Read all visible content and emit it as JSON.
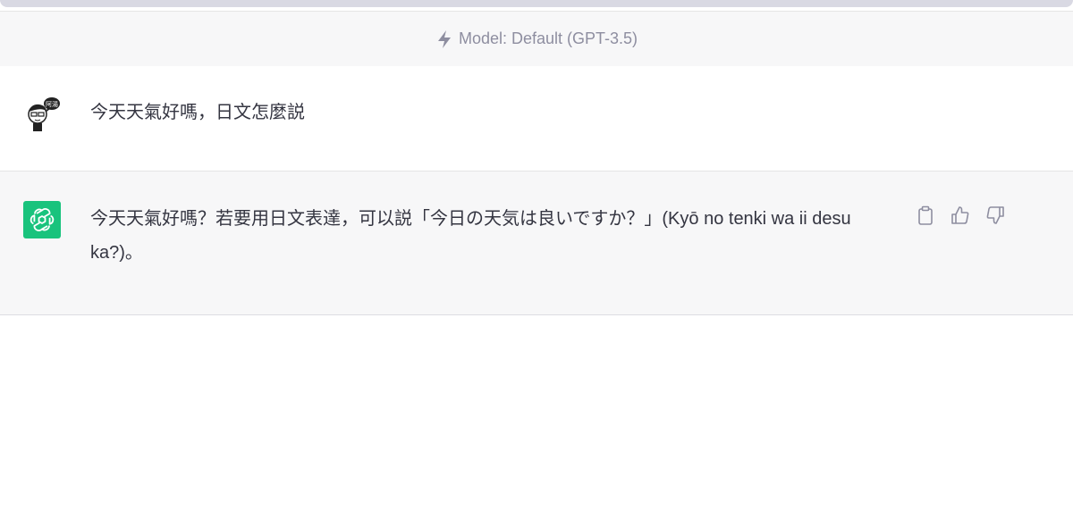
{
  "model_bar": {
    "label": "Model: Default (GPT-3.5)",
    "icon": "lightning-bolt-icon"
  },
  "messages": [
    {
      "role": "user",
      "avatar_icon": "user-avatar",
      "avatar_text": "阿湯",
      "text": "今天天氣好嗎，日文怎麼説"
    },
    {
      "role": "assistant",
      "avatar_icon": "openai-logo-icon",
      "text": "今天天氣好嗎？若要用日文表達，可以説「今日の天気は良いですか？」(Kyō no tenki wa ii desu ka?)。",
      "actions": [
        "clipboard-icon",
        "thumbs-up-icon",
        "thumbs-down-icon"
      ]
    }
  ],
  "colors": {
    "accent": "#19c37d",
    "muted": "#8e8ea0",
    "text": "#343541",
    "assistant_bg": "#f7f7f8"
  }
}
